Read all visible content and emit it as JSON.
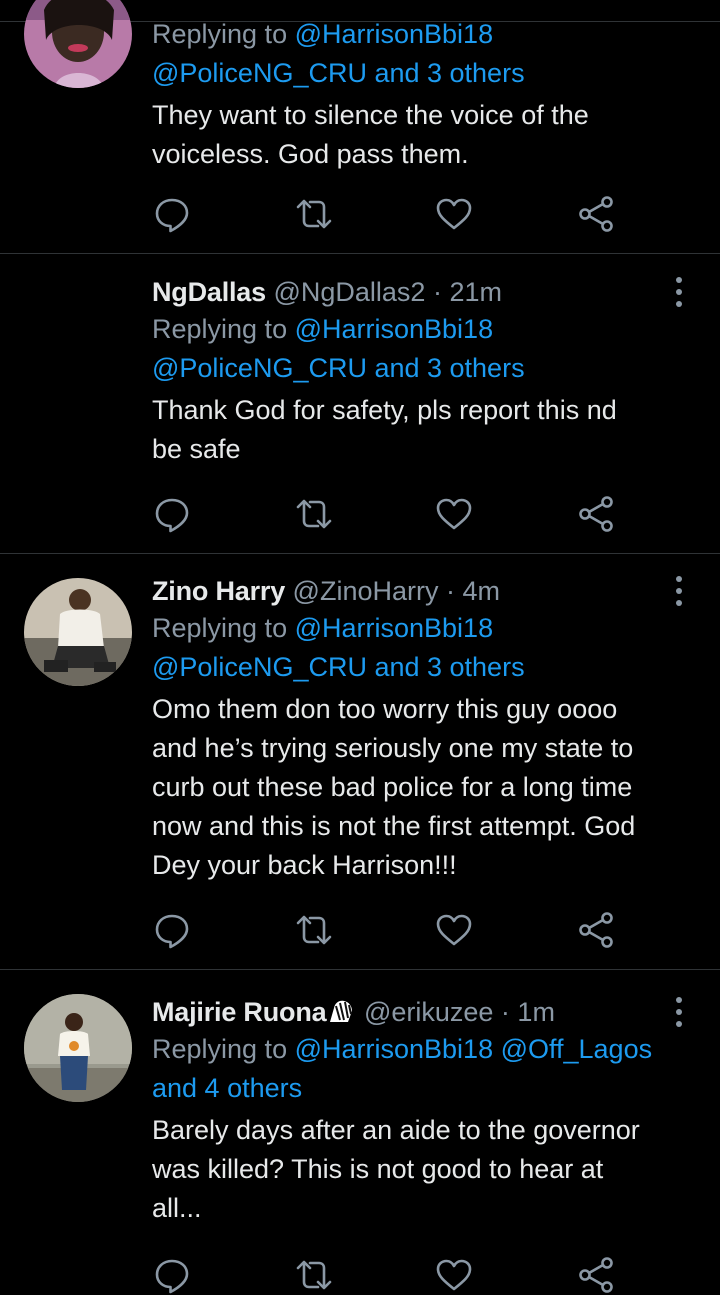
{
  "tweets": [
    {
      "reply_prefix": "Replying to ",
      "mention_line1": "@HarrisonBbi18",
      "mention_line2": "@PoliceNG_CRU and 3 others",
      "text_lines": [
        "They want to silence the voice of the",
        "voiceless. God pass them."
      ]
    },
    {
      "name": "NgDallas",
      "handle": "@NgDallas2",
      "separator": "·",
      "time": "21m",
      "reply_prefix": "Replying to ",
      "mention_line1": "@HarrisonBbi18",
      "mention_line2": "@PoliceNG_CRU and 3 others",
      "text_lines": [
        "Thank God for safety, pls report this nd",
        "be safe"
      ]
    },
    {
      "name": "Zino Harry",
      "handle": "@ZinoHarry",
      "separator": "·",
      "time": "4m",
      "reply_prefix": "Replying to ",
      "mention_line1": "@HarrisonBbi18",
      "mention_line2": "@PoliceNG_CRU and 3 others",
      "text_lines": [
        "Omo them don too worry this guy oooo",
        "and he’s trying seriously one my state to",
        "curb out these bad police for a long time",
        "now and this is not the first attempt. God",
        "Dey your back Harrison!!!"
      ]
    },
    {
      "name": "Majirie Ruona",
      "name_emoji": "zebra-emoji",
      "handle": "@erikuzee",
      "separator": "·",
      "time": "1m",
      "reply_prefix": "Replying to ",
      "mention_line1": "@HarrisonBbi18 @Off_Lagos",
      "mention_line2": "and 4 others",
      "text_lines": [
        "Barely days after an aide to the governor",
        "was killed? This is not good to hear at",
        "all..."
      ]
    }
  ],
  "icons": {
    "reply": "reply-icon",
    "retweet": "retweet-icon",
    "like": "heart-icon",
    "share": "share-icon",
    "more": "more-vertical-icon"
  },
  "colors": {
    "background": "#000000",
    "text": "#e7e9ea",
    "secondary": "#8b98a5",
    "link": "#1d9bf0",
    "divider": "#2f3336"
  }
}
